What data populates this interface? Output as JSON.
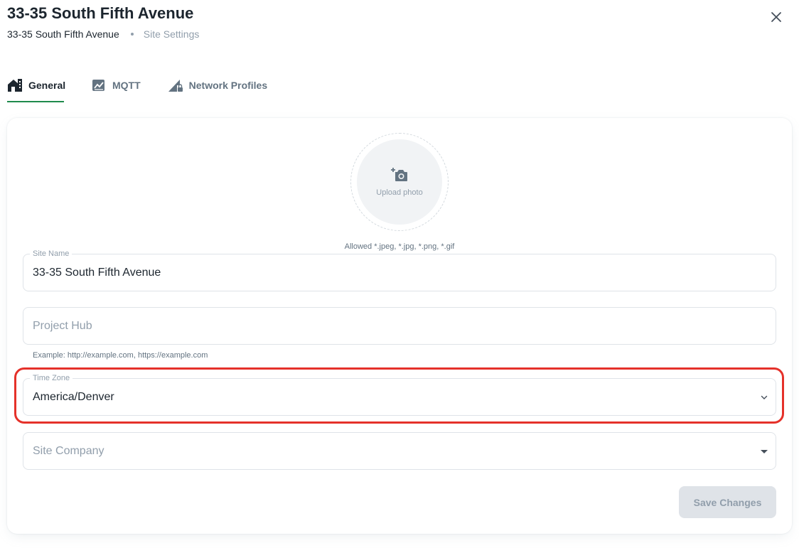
{
  "header": {
    "title": "33-35 South Fifth Avenue",
    "breadcrumb": [
      "33-35 South Fifth Avenue",
      "Site Settings"
    ]
  },
  "tabs": [
    {
      "label": "General",
      "icon": "home-icon",
      "active": true
    },
    {
      "label": "MQTT",
      "icon": "chart-line-icon",
      "active": false
    },
    {
      "label": "Network Profiles",
      "icon": "signal-lock-icon",
      "active": false
    }
  ],
  "upload": {
    "label": "Upload photo",
    "icon": "add-photo-icon",
    "allowed": "Allowed *.jpeg, *.jpg, *.png, *.gif"
  },
  "form": {
    "site_name": {
      "label": "Site Name",
      "value": "33-35 South Fifth Avenue"
    },
    "project_hub": {
      "placeholder": "Project Hub",
      "helper": "Example: http://example.com, https://example.com"
    },
    "time_zone": {
      "label": "Time Zone",
      "value": "America/Denver"
    },
    "site_company": {
      "placeholder": "Site Company"
    }
  },
  "actions": {
    "save_label": "Save Changes"
  },
  "colors": {
    "accent": "#1f8a4c",
    "highlight": "#e5312a",
    "text_primary": "#1c252e",
    "text_secondary": "#637381",
    "text_disabled": "#919eab",
    "border": "#dfe3e8"
  }
}
